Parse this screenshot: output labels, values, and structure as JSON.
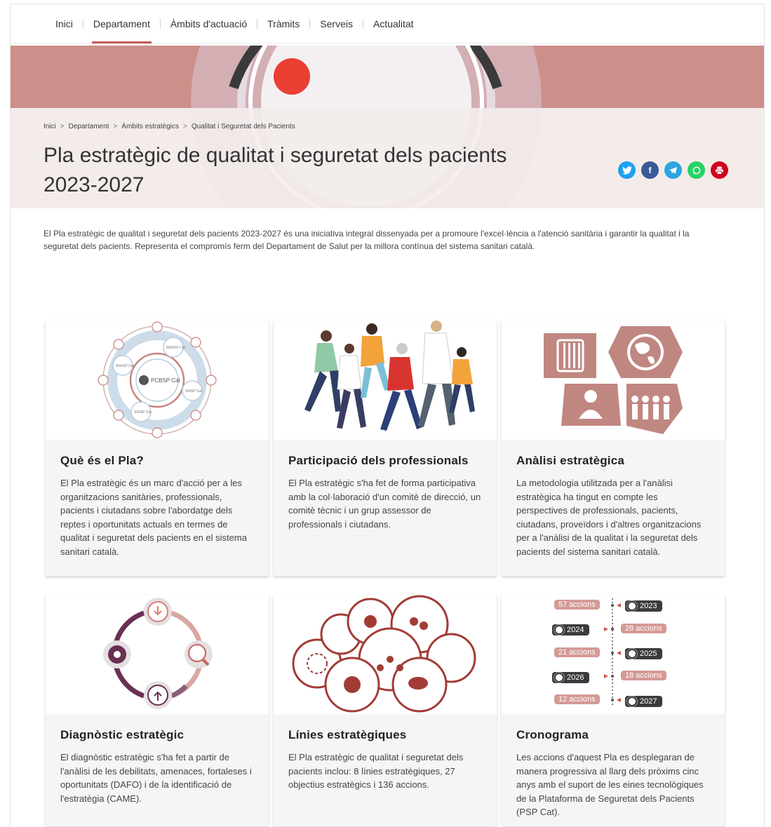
{
  "nav": {
    "items": [
      {
        "label": "Inici",
        "active": false
      },
      {
        "label": "Departament",
        "active": true
      },
      {
        "label": "Àmbits d'actuació",
        "active": false
      },
      {
        "label": "Tràmits",
        "active": false
      },
      {
        "label": "Serveis",
        "active": false
      },
      {
        "label": "Actualitat",
        "active": false
      }
    ]
  },
  "breadcrumb": [
    "Inici",
    "Departament",
    "Àmbits estratègics",
    "Qualitat i Seguretat dels Pacients"
  ],
  "page_title": "Pla estratègic de qualitat i seguretat dels pacients 2023-2027",
  "share_icons": [
    {
      "name": "twitter-icon",
      "color": "#1da1f2"
    },
    {
      "name": "facebook-icon",
      "color": "#3b5998"
    },
    {
      "name": "telegram-icon",
      "color": "#2ca5e0"
    },
    {
      "name": "whatsapp-icon",
      "color": "#25d366"
    },
    {
      "name": "print-icon",
      "color": "#d0021b"
    }
  ],
  "intro": "El Pla estratègic de qualitat i seguretat dels pacients 2023-2027 és una iniciativa integral dissenyada per a promoure l'excel·lència a l'atenció sanitària i garantir la qualitat i la seguretat dels pacients. Representa el compromís ferm del Departament de Salut per la millora contínua del sistema sanitari català.",
  "cards": [
    {
      "title": "Què és el Pla?",
      "text": "El Pla estratègic és un marc d'acció per a les organitzacions sanitàries, professionals, pacients i ciutadans sobre l'abordatge dels reptes i oportunitats actuals en termes de qualitat i seguretat dels pacients en el sistema sanitari català."
    },
    {
      "title": "Participació dels professionals",
      "text": "El Pla estratègic s'ha fet de forma participativa amb la col·laboració d'un comitè de direcció, un comitè tècnic i un grup assessor de professionals i ciutadans."
    },
    {
      "title": "Anàlisi estratègica",
      "text": "La metodologia utilitzada per a l'anàlisi estratègica ha tingut en compte les perspectives de professionals, pacients, ciutadans, proveïdors i d'altres organitzacions per a l'anàlisi de la qualitat i la seguretat dels pacients del sistema sanitari català."
    },
    {
      "title": "Diagnòstic estratègic",
      "text": "El diagnòstic estratègic s'ha fet a partir de l'anàlisi de les debilitats, amenaces, fortaleses i oportunitats (DAFO) i de la identificació de l'estratègia (CAME)."
    },
    {
      "title": "Línies estratègiques",
      "text": "El Pla estratègic de qualitat i seguretat dels pacients inclou: 8 línies estratègiques, 27 objectius estratègics i 136 accions."
    },
    {
      "title": "Cronograma",
      "text": "Les accions d'aquest Pla es desplegaran de manera progressiva al llarg dels pròxims cinc anys amb el suport de les eines tecnològiques de la Plataforma de Seguretat dels Pacients (PSP Cat)."
    }
  ],
  "card1_image": {
    "center_label": "PCBSP Cat",
    "node_labels": [
      "MARSP Cat",
      "SNiSP Cat",
      "WebSP Cat",
      "SIGSP Cat"
    ]
  },
  "timeline": [
    {
      "year": "2023",
      "actions": "57 accions"
    },
    {
      "year": "2024",
      "actions": "28 accions"
    },
    {
      "year": "2025",
      "actions": "21 accions"
    },
    {
      "year": "2026",
      "actions": "18 accions"
    },
    {
      "year": "2027",
      "actions": "12 accions"
    }
  ],
  "colors": {
    "brand": "#c05c57",
    "hero_band": "#cc8f89",
    "hero_bg": "#f3ecea",
    "illustration": "#a85a55"
  }
}
